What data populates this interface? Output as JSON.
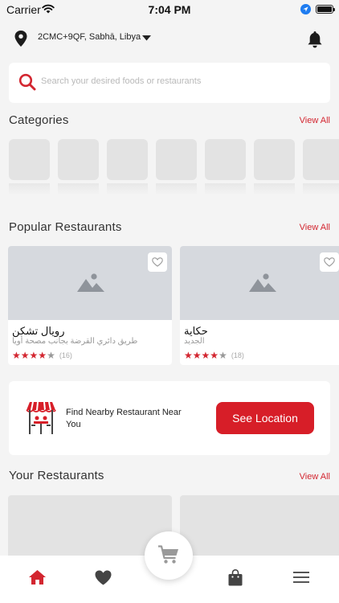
{
  "status_bar": {
    "carrier": "Carrier",
    "time": "7:04 PM"
  },
  "header": {
    "location_label": "2CMC+9QF, Sabhā, Libya",
    "location_icon": "map-pin-icon",
    "notification_icon": "bell-icon"
  },
  "search": {
    "placeholder": "Search your desired foods or restaurants",
    "icon": "search-icon"
  },
  "categories": {
    "title": "Categories",
    "view_all": "View All",
    "placeholder_count": 7
  },
  "popular": {
    "title": "Popular Restaurants",
    "view_all": "View All",
    "items": [
      {
        "name": "رويال تشكن",
        "address": "طريق دائري القرضة بجانب مصحة أويا",
        "rating": 4,
        "max_rating": 5,
        "review_count": "(16)",
        "favorite_icon": "heart-outline-icon",
        "image_icon": "image-placeholder-icon"
      },
      {
        "name": "حكاية",
        "address": "الجديد",
        "rating": 4,
        "max_rating": 5,
        "review_count": "(18)",
        "favorite_icon": "heart-outline-icon",
        "image_icon": "image-placeholder-icon"
      }
    ]
  },
  "promo": {
    "text": "Find Nearby Restaurant Near You",
    "button_label": "See Location",
    "icon": "restaurant-table-icon"
  },
  "your_restaurants": {
    "title": "Your Restaurants",
    "view_all": "View All"
  },
  "tab_bar": {
    "items": [
      {
        "name": "home",
        "icon": "home-icon",
        "active": true
      },
      {
        "name": "favorites",
        "icon": "heart-icon",
        "active": false
      },
      {
        "name": "cart",
        "icon": "cart-icon",
        "active": false
      },
      {
        "name": "orders",
        "icon": "shopping-bag-icon",
        "active": false
      },
      {
        "name": "menu",
        "icon": "hamburger-menu-icon",
        "active": false
      }
    ]
  },
  "colors": {
    "accent": "#d71e28",
    "background": "#f4f4f4",
    "card": "#ffffff",
    "placeholder": "#e3e3e3"
  }
}
